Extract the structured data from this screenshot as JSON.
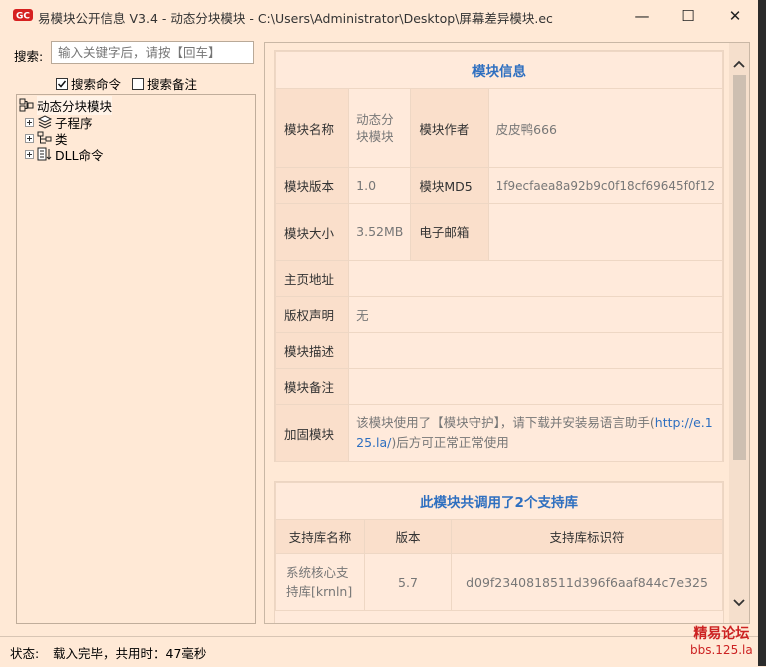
{
  "window": {
    "title": "易模块公开信息 V3.4 - 动态分块模块 - C:\\Users\\Administrator\\Desktop\\屏幕差异模块.ec",
    "minimize_glyph": "—",
    "maximize_glyph": "☐",
    "close_glyph": "✕"
  },
  "search": {
    "label": "搜索:",
    "placeholder": "输入关键字后，请按【回车】",
    "option_commands": "搜索命令",
    "option_commands_checked": true,
    "option_notes": "搜索备注",
    "option_notes_checked": false
  },
  "tree": {
    "root": "动态分块模块",
    "children": [
      "子程序",
      "类",
      "DLL命令"
    ]
  },
  "module_info": {
    "title": "模块信息",
    "name_label": "模块名称",
    "name_value": "动态分块模块",
    "author_label": "模块作者",
    "author_value": "皮皮鸭666",
    "version_label": "模块版本",
    "version_value": "1.0",
    "md5_label": "模块MD5",
    "md5_value": "1f9ecfaea8a92b9c0f18cf69645f0f12",
    "size_label": "模块大小",
    "size_value": "3.52MB",
    "email_label": "电子邮箱",
    "email_value": "",
    "homepage_label": "主页地址",
    "homepage_value": "",
    "copyright_label": "版权声明",
    "copyright_value": "无",
    "desc_label": "模块描述",
    "desc_value": "",
    "note_label": "模块备注",
    "note_value": "",
    "protect_label": "加固模块",
    "protect_text_before": "该模块使用了【模块守护】，请下载并安装易语言助手(",
    "protect_link": "http://e.125.la/",
    "protect_text_after": ")后方可正常正常使用"
  },
  "support_libs": {
    "title": "此模块共调用了2个支持库",
    "col_name": "支持库名称",
    "col_version": "版本",
    "col_id": "支持库标识符",
    "rows": [
      {
        "name": "系统核心支持库[krnln]",
        "version": "5.7",
        "id": "d09f2340818511d396f6aaf844c7e325"
      }
    ]
  },
  "status": {
    "label": "状态:",
    "text": "载入完毕，共用时：47毫秒"
  },
  "watermark": {
    "line1": "精易论坛",
    "line2": "bbs.125.la"
  },
  "colors": {
    "background": "#ffe9d6",
    "accent": "#2e6fc0",
    "watermark": "#cc2222"
  }
}
